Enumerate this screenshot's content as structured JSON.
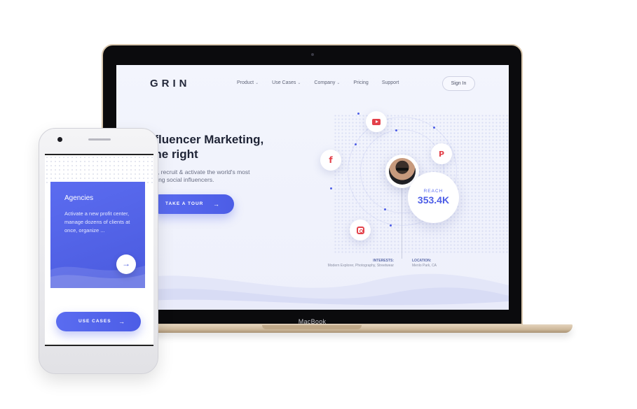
{
  "laptop": {
    "brand_label": "MacBook"
  },
  "site": {
    "logo": "GRIN",
    "nav": [
      {
        "label": "Product",
        "has_dropdown": true
      },
      {
        "label": "Use Cases",
        "has_dropdown": true
      },
      {
        "label": "Company",
        "has_dropdown": true
      },
      {
        "label": "Pricing",
        "has_dropdown": false
      },
      {
        "label": "Support",
        "has_dropdown": false
      }
    ],
    "signin_label": "Sign In",
    "hero": {
      "title_line1": "nfluencer Marketing,",
      "title_line2": "one right",
      "subtitle_line1": "ntify, recruit & activate the world's most",
      "subtitle_line2": "gaging social influencers.",
      "cta_label": "TAKE A TOUR",
      "cta_arrow": "→"
    },
    "influencer": {
      "reach_label": "REACH",
      "reach_value": "353.4K",
      "interests_label": "INTERESTS:",
      "interests_value": "Modern Explorer, Photography, Streetwear",
      "location_label": "LOCATION:",
      "location_value": "Menlo Park, CA"
    },
    "social_icons": [
      "youtube-icon",
      "facebook-icon",
      "pinterest-icon",
      "instagram-icon"
    ],
    "social_glyphs": {
      "facebook": "f",
      "pinterest": "P"
    }
  },
  "phone": {
    "card_title": "Agencies",
    "card_text": "Activate a new profit center, manage dozens of clients at once, organize ...",
    "card_arrow": "→",
    "button_label": "USE CASES",
    "button_arrow": "→"
  },
  "colors": {
    "accent": "#4c5de6",
    "social_red": "#e3414a",
    "heading": "#1f2436"
  }
}
